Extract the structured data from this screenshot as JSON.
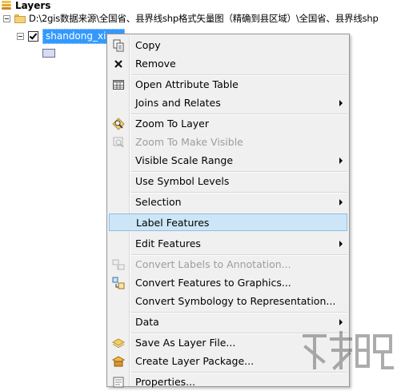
{
  "toc": {
    "title": "Layers",
    "path": "D:\\2gis数据来源\\全国省、县界线shp格式矢量图（精确到县区域）\\全国省、县界线shp",
    "layer_name": "shandong_xia..."
  },
  "context_menu": {
    "items": [
      {
        "label": "Copy",
        "icon": "copy-icon"
      },
      {
        "label": "Remove",
        "icon": "remove-icon"
      },
      {
        "label": "Open Attribute Table",
        "icon": "table-icon"
      },
      {
        "label": "Joins and Relates",
        "icon": "none"
      },
      {
        "label": "Zoom To Layer",
        "icon": "zoom-to-layer-icon"
      },
      {
        "label": "Zoom To Make Visible",
        "icon": "zoom-visible-icon"
      },
      {
        "label": "Visible Scale Range",
        "icon": "none"
      },
      {
        "label": "Use Symbol Levels",
        "icon": "none"
      },
      {
        "label": "Selection",
        "icon": "none"
      },
      {
        "label": "Label Features",
        "icon": "none"
      },
      {
        "label": "Edit Features",
        "icon": "none"
      },
      {
        "label": "Convert Labels to Annotation...",
        "icon": "convert-labels-icon"
      },
      {
        "label": "Convert Features to Graphics...",
        "icon": "convert-features-icon"
      },
      {
        "label": "Convert Symbology to Representation...",
        "icon": "none"
      },
      {
        "label": "Data",
        "icon": "none"
      },
      {
        "label": "Save As Layer File...",
        "icon": "layer-file-icon"
      },
      {
        "label": "Create Layer Package...",
        "icon": "layer-package-icon"
      },
      {
        "label": "Properties...",
        "icon": "properties-icon"
      }
    ]
  },
  "colors": {
    "selection": "#3399ff",
    "menu_background": "#f0f0f0",
    "menu_highlight": "#cde6f7",
    "disabled_text": "#9d9d9d"
  }
}
